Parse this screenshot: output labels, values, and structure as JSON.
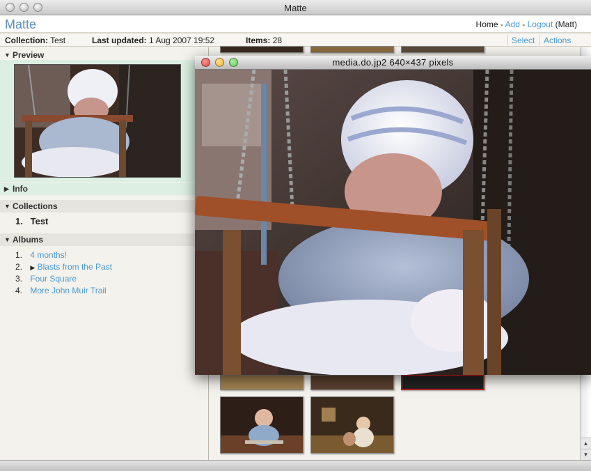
{
  "window": {
    "title": "Matte"
  },
  "header": {
    "app_name": "Matte",
    "nav": {
      "home": "Home",
      "sep1": "-",
      "add": "Add",
      "sep2": "-",
      "logout": "Logout",
      "user": "(Matt)"
    }
  },
  "infobar": {
    "collection_label": "Collection:",
    "collection_value": "Test",
    "updated_label": "Last updated:",
    "updated_value": "1 Aug 2007 19:52",
    "items_label": "Items:",
    "items_value": "28",
    "select": "Select",
    "actions": "Actions"
  },
  "sidebar": {
    "preview": "Preview",
    "info": "Info",
    "collections": {
      "heading": "Collections",
      "items": [
        {
          "num": "1.",
          "label": "Test"
        }
      ]
    },
    "albums": {
      "heading": "Albums",
      "items": [
        {
          "num": "1.",
          "label": "4 months!"
        },
        {
          "num": "2.",
          "label": "Blasts from the Past"
        },
        {
          "num": "3.",
          "label": "Four Square"
        },
        {
          "num": "4.",
          "label": "More John Muir Trail"
        }
      ]
    }
  },
  "media_window": {
    "title": "media.do.jp2 640×437 pixels"
  },
  "colors": {
    "accent": "#4a9ad4",
    "preview_bg": "#dcefe2",
    "close": "#e0443e",
    "minimize": "#f0b43a",
    "zoom": "#62c554"
  },
  "icons": {
    "disclosure_open": "▼",
    "disclosure_closed": "▶"
  }
}
